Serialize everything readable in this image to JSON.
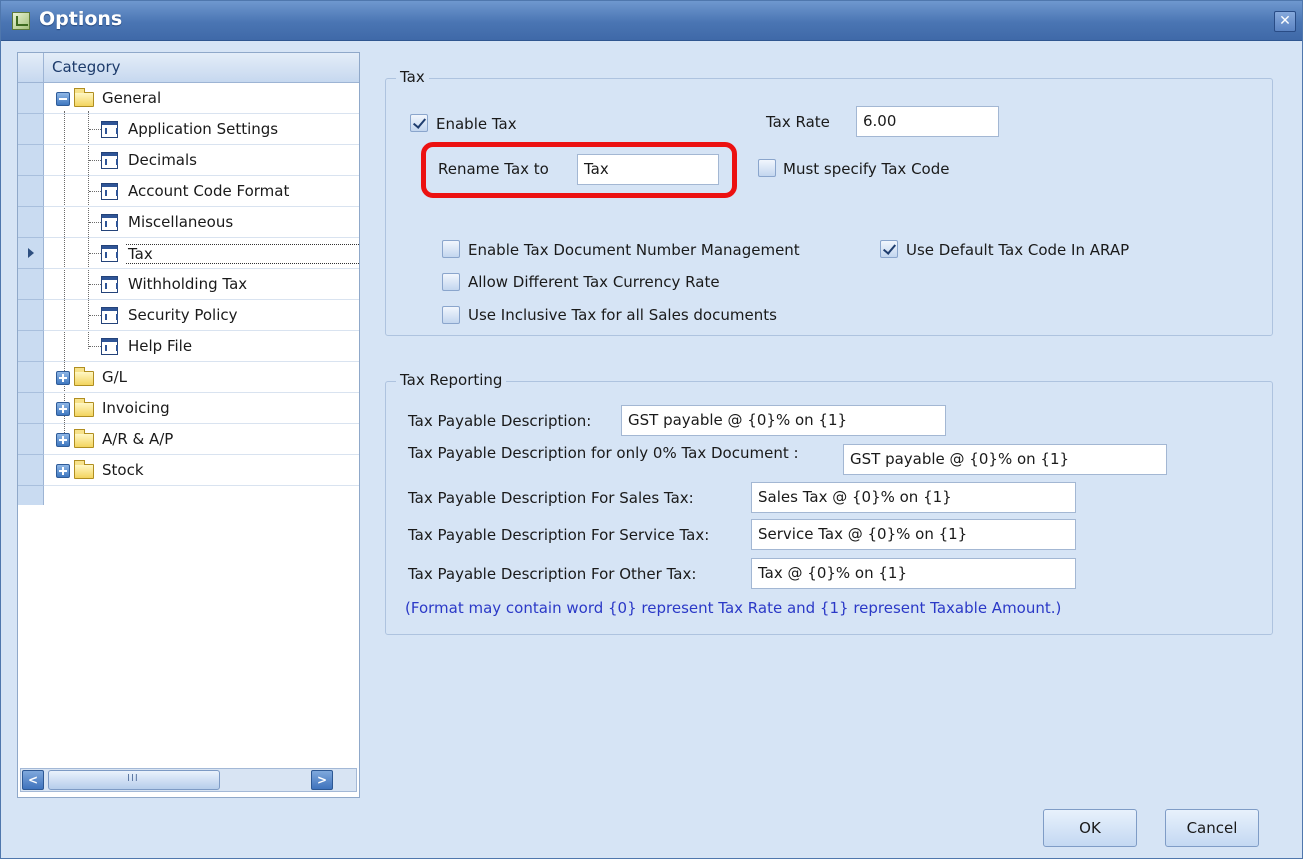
{
  "window": {
    "title": "Options",
    "close_glyph": "✕"
  },
  "tree": {
    "header": "Category",
    "groups": [
      {
        "label": "General",
        "expanded": true,
        "children": [
          "Application Settings",
          "Decimals",
          "Account Code Format",
          "Miscellaneous",
          "Tax",
          "Withholding Tax",
          "Security Policy",
          "Help File"
        ]
      },
      {
        "label": "G/L",
        "expanded": false
      },
      {
        "label": "Invoicing",
        "expanded": false
      },
      {
        "label": "A/R & A/P",
        "expanded": false
      },
      {
        "label": "Stock",
        "expanded": false
      }
    ],
    "selected": "Tax",
    "scroll_grip": "III"
  },
  "tax": {
    "legend": "Tax",
    "enable_tax": {
      "label": "Enable Tax",
      "checked": true
    },
    "tax_rate": {
      "label": "Tax Rate",
      "value": "6.00"
    },
    "rename_tax": {
      "label": "Rename Tax to",
      "value": "Tax"
    },
    "must_specify_tax_code": {
      "label": "Must specify Tax Code",
      "checked": false
    },
    "enable_doc_number_mgmt": {
      "label": "Enable Tax Document Number Management",
      "checked": false
    },
    "use_default_tax_code_arap": {
      "label": "Use Default Tax Code In ARAP",
      "checked": true
    },
    "allow_diff_currency_rate": {
      "label": "Allow Different Tax Currency Rate",
      "checked": false
    },
    "use_inclusive_tax": {
      "label": "Use Inclusive Tax for all Sales documents",
      "checked": false
    }
  },
  "tax_reporting": {
    "legend": "Tax Reporting",
    "payable": {
      "label": "Tax Payable Description:",
      "value": "GST payable @ {0}% on {1}"
    },
    "payable_zero": {
      "label": "Tax Payable Description for only 0% Tax Document :",
      "value": "GST payable @ {0}% on {1}"
    },
    "sales": {
      "label": "Tax Payable Description For Sales Tax:",
      "value": "Sales Tax @ {0}% on {1}"
    },
    "service": {
      "label": "Tax Payable Description For Service Tax:",
      "value": "Service Tax @ {0}% on {1}"
    },
    "other": {
      "label": "Tax Payable Description For Other Tax:",
      "value": "Tax @ {0}% on {1}"
    },
    "note": "(Format may contain word {0} represent Tax Rate and {1} represent Taxable Amount.)"
  },
  "buttons": {
    "ok": "OK",
    "cancel": "Cancel"
  },
  "colors": {
    "highlight": "#ec1111",
    "note": "#2b39c7",
    "title_bar": "#4a75b3",
    "window_bg": "#d6e4f5"
  }
}
